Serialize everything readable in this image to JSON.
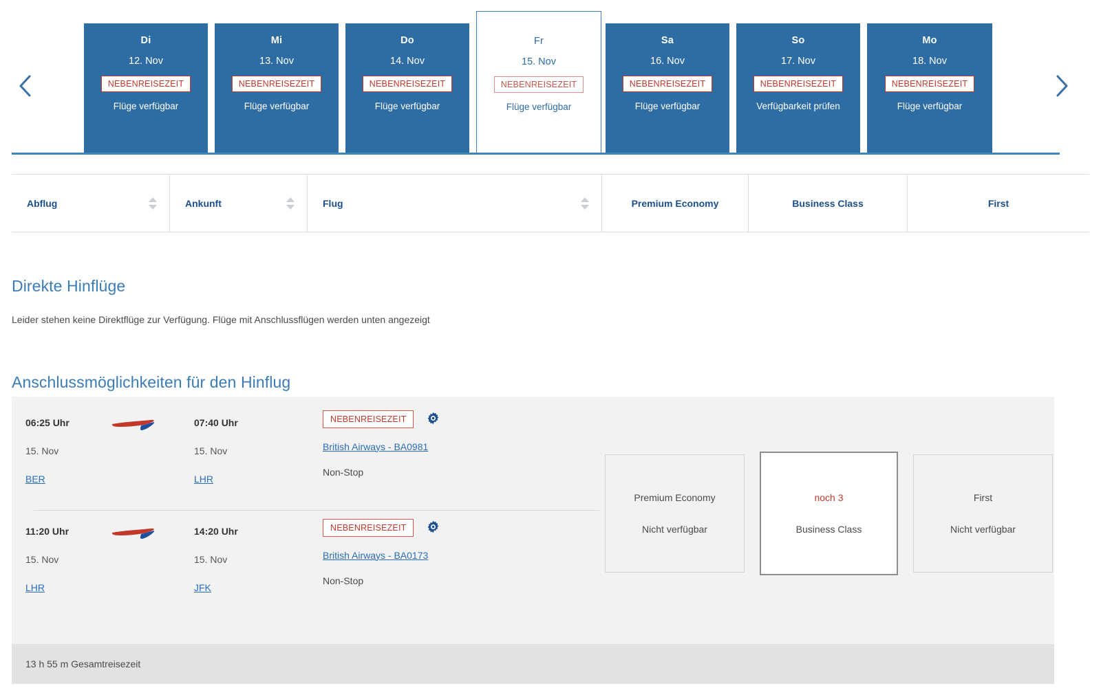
{
  "date_strip": {
    "prev_label": "‹",
    "next_label": "›",
    "tiles": [
      {
        "dow": "Di",
        "date": "12. Nov",
        "badge": "NEBENREISEZEIT",
        "availability": "Flüge verfügbar",
        "selected": false
      },
      {
        "dow": "Mi",
        "date": "13. Nov",
        "badge": "NEBENREISEZEIT",
        "availability": "Flüge verfügbar",
        "selected": false
      },
      {
        "dow": "Do",
        "date": "14. Nov",
        "badge": "NEBENREISEZEIT",
        "availability": "Flüge verfügbar",
        "selected": false
      },
      {
        "dow": "Fr",
        "date": "15. Nov",
        "badge": "NEBENREISEZEIT",
        "availability": "Flüge verfügbar",
        "selected": true
      },
      {
        "dow": "Sa",
        "date": "16. Nov",
        "badge": "NEBENREISEZEIT",
        "availability": "Flüge verfügbar",
        "selected": false
      },
      {
        "dow": "So",
        "date": "17. Nov",
        "badge": "NEBENREISEZEIT",
        "availability": "Verfügbarkeit prüfen",
        "selected": false
      },
      {
        "dow": "Mo",
        "date": "18. Nov",
        "badge": "NEBENREISEZEIT",
        "availability": "Flüge verfügbar",
        "selected": false
      }
    ]
  },
  "columns": [
    {
      "label": "Abflug",
      "sortable": true
    },
    {
      "label": "Ankunft",
      "sortable": true
    },
    {
      "label": "Flug",
      "sortable": true
    },
    {
      "label": "Premium Economy",
      "sortable": false
    },
    {
      "label": "Business Class",
      "sortable": false
    },
    {
      "label": "First",
      "sortable": false
    }
  ],
  "direct_section": {
    "heading": "Direkte Hinflüge",
    "message": "Leider stehen keine Direktflüge zur Verfügung. Flüge mit Anschlussflügen werden unten angezeigt"
  },
  "connections_section": {
    "heading": "Anschlussmöglichkeiten für den Hinflug"
  },
  "itinerary": {
    "segments": [
      {
        "dep_time": "06:25 Uhr",
        "dep_date": "15. Nov",
        "dep_airport": "BER",
        "arr_time": "07:40 Uhr",
        "arr_date": "15. Nov",
        "arr_airport": "LHR",
        "badge": "NEBENREISEZEIT",
        "flight_number": "British Airways - BA0981",
        "stops": "Non-Stop",
        "airline_logo": "british-airways-speedmarque"
      },
      {
        "dep_time": "11:20 Uhr",
        "dep_date": "15. Nov",
        "dep_airport": "LHR",
        "arr_time": "14:20 Uhr",
        "arr_date": "15. Nov",
        "arr_airport": "JFK",
        "badge": "NEBENREISEZEIT",
        "flight_number": "British Airways - BA0173",
        "stops": "Non-Stop",
        "airline_logo": "british-airways-speedmarque"
      }
    ],
    "fares": [
      {
        "line1": "Premium Economy",
        "line2": "Nicht verfügbar",
        "selected": false
      },
      {
        "line1": "noch 3",
        "line2": "Business Class",
        "selected": true
      },
      {
        "line1": "First",
        "line2": "Nicht verfügbar",
        "selected": false
      }
    ],
    "total_duration": "13 h 55 m Gesamtreisezeit"
  },
  "colors": {
    "tile_blue": "#2e6ca4",
    "accent_blue": "#2a6ebb",
    "heading_blue": "#3a7cb5",
    "badge_red": "#c0392b",
    "rule_blue": "#3d86bd"
  }
}
